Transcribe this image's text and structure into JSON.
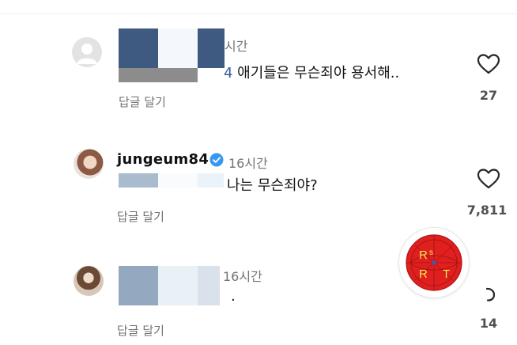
{
  "comments": [
    {
      "time_suffix": "시간",
      "mention_suffix": "4",
      "text": " 애기들은 무슨죄야  용서해..",
      "reply_label": "답글 달기",
      "like_count": "27"
    },
    {
      "username": "jungeum84",
      "time": "16시간",
      "text": "나는 무슨죄야?",
      "reply_label": "답글 달기",
      "like_count": "7,811"
    },
    {
      "time": "16시간",
      "text": ".",
      "reply_label": "답글 달기",
      "like_count": "14"
    }
  ],
  "stamp": {
    "letters": [
      "R",
      "s",
      "R",
      "T"
    ],
    "color": "#e01f1f"
  },
  "colors": {
    "heart_outline": "#262626",
    "muted_text": "#737373",
    "verified_badge": "#3897f0",
    "mention": "#375d9b"
  },
  "icons": [
    "default-avatar-icon",
    "verified-badge-icon",
    "heart-icon",
    "refresh-icon"
  ]
}
